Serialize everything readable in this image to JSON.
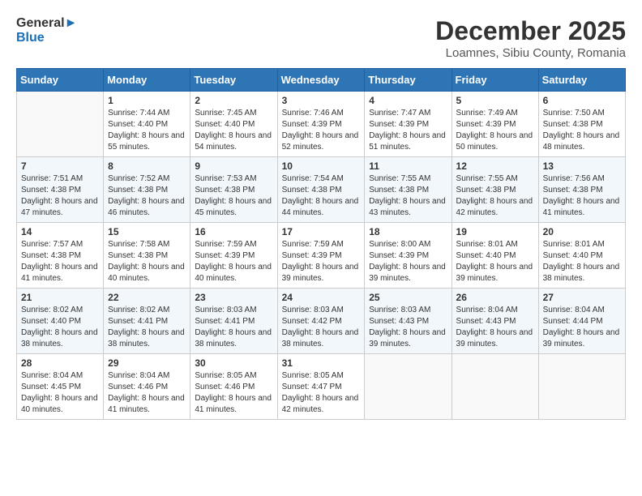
{
  "header": {
    "logo_line1": "General",
    "logo_line2": "Blue",
    "title": "December 2025",
    "subtitle": "Loamnes, Sibiu County, Romania"
  },
  "calendar": {
    "days_of_week": [
      "Sunday",
      "Monday",
      "Tuesday",
      "Wednesday",
      "Thursday",
      "Friday",
      "Saturday"
    ],
    "weeks": [
      [
        {
          "day": "",
          "sunrise": "",
          "sunset": "",
          "daylight": ""
        },
        {
          "day": "1",
          "sunrise": "Sunrise: 7:44 AM",
          "sunset": "Sunset: 4:40 PM",
          "daylight": "Daylight: 8 hours and 55 minutes."
        },
        {
          "day": "2",
          "sunrise": "Sunrise: 7:45 AM",
          "sunset": "Sunset: 4:40 PM",
          "daylight": "Daylight: 8 hours and 54 minutes."
        },
        {
          "day": "3",
          "sunrise": "Sunrise: 7:46 AM",
          "sunset": "Sunset: 4:39 PM",
          "daylight": "Daylight: 8 hours and 52 minutes."
        },
        {
          "day": "4",
          "sunrise": "Sunrise: 7:47 AM",
          "sunset": "Sunset: 4:39 PM",
          "daylight": "Daylight: 8 hours and 51 minutes."
        },
        {
          "day": "5",
          "sunrise": "Sunrise: 7:49 AM",
          "sunset": "Sunset: 4:39 PM",
          "daylight": "Daylight: 8 hours and 50 minutes."
        },
        {
          "day": "6",
          "sunrise": "Sunrise: 7:50 AM",
          "sunset": "Sunset: 4:38 PM",
          "daylight": "Daylight: 8 hours and 48 minutes."
        }
      ],
      [
        {
          "day": "7",
          "sunrise": "Sunrise: 7:51 AM",
          "sunset": "Sunset: 4:38 PM",
          "daylight": "Daylight: 8 hours and 47 minutes."
        },
        {
          "day": "8",
          "sunrise": "Sunrise: 7:52 AM",
          "sunset": "Sunset: 4:38 PM",
          "daylight": "Daylight: 8 hours and 46 minutes."
        },
        {
          "day": "9",
          "sunrise": "Sunrise: 7:53 AM",
          "sunset": "Sunset: 4:38 PM",
          "daylight": "Daylight: 8 hours and 45 minutes."
        },
        {
          "day": "10",
          "sunrise": "Sunrise: 7:54 AM",
          "sunset": "Sunset: 4:38 PM",
          "daylight": "Daylight: 8 hours and 44 minutes."
        },
        {
          "day": "11",
          "sunrise": "Sunrise: 7:55 AM",
          "sunset": "Sunset: 4:38 PM",
          "daylight": "Daylight: 8 hours and 43 minutes."
        },
        {
          "day": "12",
          "sunrise": "Sunrise: 7:55 AM",
          "sunset": "Sunset: 4:38 PM",
          "daylight": "Daylight: 8 hours and 42 minutes."
        },
        {
          "day": "13",
          "sunrise": "Sunrise: 7:56 AM",
          "sunset": "Sunset: 4:38 PM",
          "daylight": "Daylight: 8 hours and 41 minutes."
        }
      ],
      [
        {
          "day": "14",
          "sunrise": "Sunrise: 7:57 AM",
          "sunset": "Sunset: 4:38 PM",
          "daylight": "Daylight: 8 hours and 41 minutes."
        },
        {
          "day": "15",
          "sunrise": "Sunrise: 7:58 AM",
          "sunset": "Sunset: 4:38 PM",
          "daylight": "Daylight: 8 hours and 40 minutes."
        },
        {
          "day": "16",
          "sunrise": "Sunrise: 7:59 AM",
          "sunset": "Sunset: 4:39 PM",
          "daylight": "Daylight: 8 hours and 40 minutes."
        },
        {
          "day": "17",
          "sunrise": "Sunrise: 7:59 AM",
          "sunset": "Sunset: 4:39 PM",
          "daylight": "Daylight: 8 hours and 39 minutes."
        },
        {
          "day": "18",
          "sunrise": "Sunrise: 8:00 AM",
          "sunset": "Sunset: 4:39 PM",
          "daylight": "Daylight: 8 hours and 39 minutes."
        },
        {
          "day": "19",
          "sunrise": "Sunrise: 8:01 AM",
          "sunset": "Sunset: 4:40 PM",
          "daylight": "Daylight: 8 hours and 39 minutes."
        },
        {
          "day": "20",
          "sunrise": "Sunrise: 8:01 AM",
          "sunset": "Sunset: 4:40 PM",
          "daylight": "Daylight: 8 hours and 38 minutes."
        }
      ],
      [
        {
          "day": "21",
          "sunrise": "Sunrise: 8:02 AM",
          "sunset": "Sunset: 4:40 PM",
          "daylight": "Daylight: 8 hours and 38 minutes."
        },
        {
          "day": "22",
          "sunrise": "Sunrise: 8:02 AM",
          "sunset": "Sunset: 4:41 PM",
          "daylight": "Daylight: 8 hours and 38 minutes."
        },
        {
          "day": "23",
          "sunrise": "Sunrise: 8:03 AM",
          "sunset": "Sunset: 4:41 PM",
          "daylight": "Daylight: 8 hours and 38 minutes."
        },
        {
          "day": "24",
          "sunrise": "Sunrise: 8:03 AM",
          "sunset": "Sunset: 4:42 PM",
          "daylight": "Daylight: 8 hours and 38 minutes."
        },
        {
          "day": "25",
          "sunrise": "Sunrise: 8:03 AM",
          "sunset": "Sunset: 4:43 PM",
          "daylight": "Daylight: 8 hours and 39 minutes."
        },
        {
          "day": "26",
          "sunrise": "Sunrise: 8:04 AM",
          "sunset": "Sunset: 4:43 PM",
          "daylight": "Daylight: 8 hours and 39 minutes."
        },
        {
          "day": "27",
          "sunrise": "Sunrise: 8:04 AM",
          "sunset": "Sunset: 4:44 PM",
          "daylight": "Daylight: 8 hours and 39 minutes."
        }
      ],
      [
        {
          "day": "28",
          "sunrise": "Sunrise: 8:04 AM",
          "sunset": "Sunset: 4:45 PM",
          "daylight": "Daylight: 8 hours and 40 minutes."
        },
        {
          "day": "29",
          "sunrise": "Sunrise: 8:04 AM",
          "sunset": "Sunset: 4:46 PM",
          "daylight": "Daylight: 8 hours and 41 minutes."
        },
        {
          "day": "30",
          "sunrise": "Sunrise: 8:05 AM",
          "sunset": "Sunset: 4:46 PM",
          "daylight": "Daylight: 8 hours and 41 minutes."
        },
        {
          "day": "31",
          "sunrise": "Sunrise: 8:05 AM",
          "sunset": "Sunset: 4:47 PM",
          "daylight": "Daylight: 8 hours and 42 minutes."
        },
        {
          "day": "",
          "sunrise": "",
          "sunset": "",
          "daylight": ""
        },
        {
          "day": "",
          "sunrise": "",
          "sunset": "",
          "daylight": ""
        },
        {
          "day": "",
          "sunrise": "",
          "sunset": "",
          "daylight": ""
        }
      ]
    ]
  }
}
